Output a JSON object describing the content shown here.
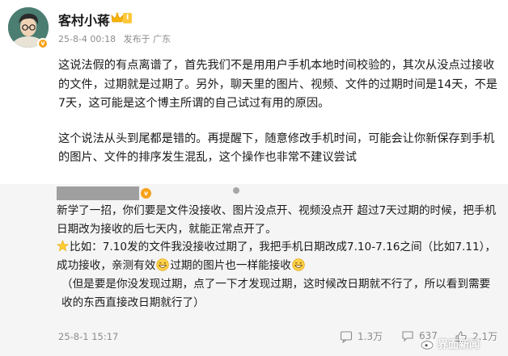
{
  "post": {
    "author": "客村小蒋",
    "vip_level": "I",
    "date": "25-8-4 00:18",
    "location": "发布于 广东",
    "paragraphs": [
      "这说法假的有点离谱了，首先我们不是用用户手机本地时间校验的，其次从没点过接收的文件，过期就是过期了。另外，聊天里的图片、视频、文件的过期时间是14天，不是7天，这可能是这个博主所谓的自己试过有用的原因。",
      "这个说法从头到尾都是错的。再提醒下，随意修改手机时间，可能会让你新保存到手机的图片、文件的排序发生混乱，这个操作也非常不建议尝试"
    ]
  },
  "comment": {
    "line1": "新学了一招，你们要是文件没接收、图片没点开、视频没点开 超过7天过期的时候，把手机日期改为接收的后七天内，就能正常点开了。",
    "line2_a": "比如：7.10发的文件我没接收过期了，我把手机日期改成7.10-7.16之间（比如7.11），成功接收，亲测有效",
    "line2_b": "过期的图片也一样能接收",
    "line3": "（但是要是你没发现过期，点了一下才发现过期，这时候改日期就不行了，所以看到需要收的东西直接改日期就行了）"
  },
  "footer": {
    "date": "25-8-1 15:17",
    "reposts": "1.3万",
    "comments": "637",
    "likes": "2.1万"
  },
  "watermark": "界面新闻",
  "icons": {
    "avatar_badge": "v-badge-icon",
    "vip": "crown-icon",
    "star": "star-emoji-icon",
    "grin": "grinning-emoji-icon",
    "repost": "repost-icon",
    "comment": "comment-icon",
    "like": "like-icon"
  },
  "colors": {
    "badge": "#f7a21b",
    "meta_text": "#8c8c8c",
    "comment_bg": "#f5f5f5",
    "redaction": "#9f9f9f"
  }
}
